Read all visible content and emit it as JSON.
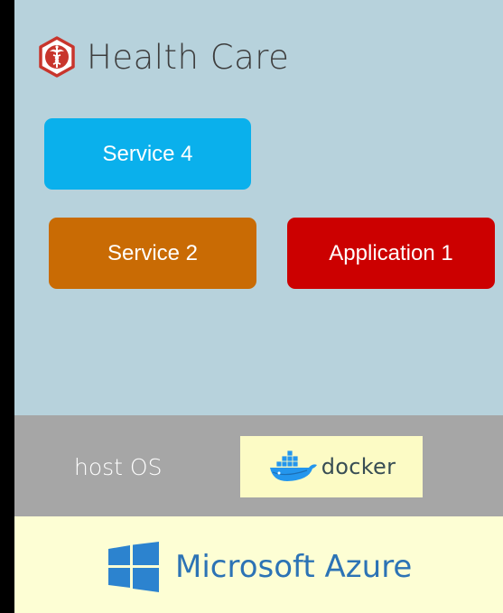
{
  "header": {
    "title": "Health Care",
    "icon": "caduceus-icon",
    "icon_color": "#c8352c"
  },
  "services": {
    "service4": {
      "label": "Service 4",
      "color": "#0ab0ec"
    },
    "service2": {
      "label": "Service 2",
      "color": "#c96b04"
    },
    "application1": {
      "label": "Application 1",
      "color": "#cc0000"
    }
  },
  "host_layer": {
    "label": "host OS",
    "docker": {
      "label": "docker",
      "icon": "docker-whale-icon"
    }
  },
  "cloud_layer": {
    "label": "Microsoft Azure",
    "icon": "windows-logo-icon",
    "color": "#2c73b5"
  }
}
